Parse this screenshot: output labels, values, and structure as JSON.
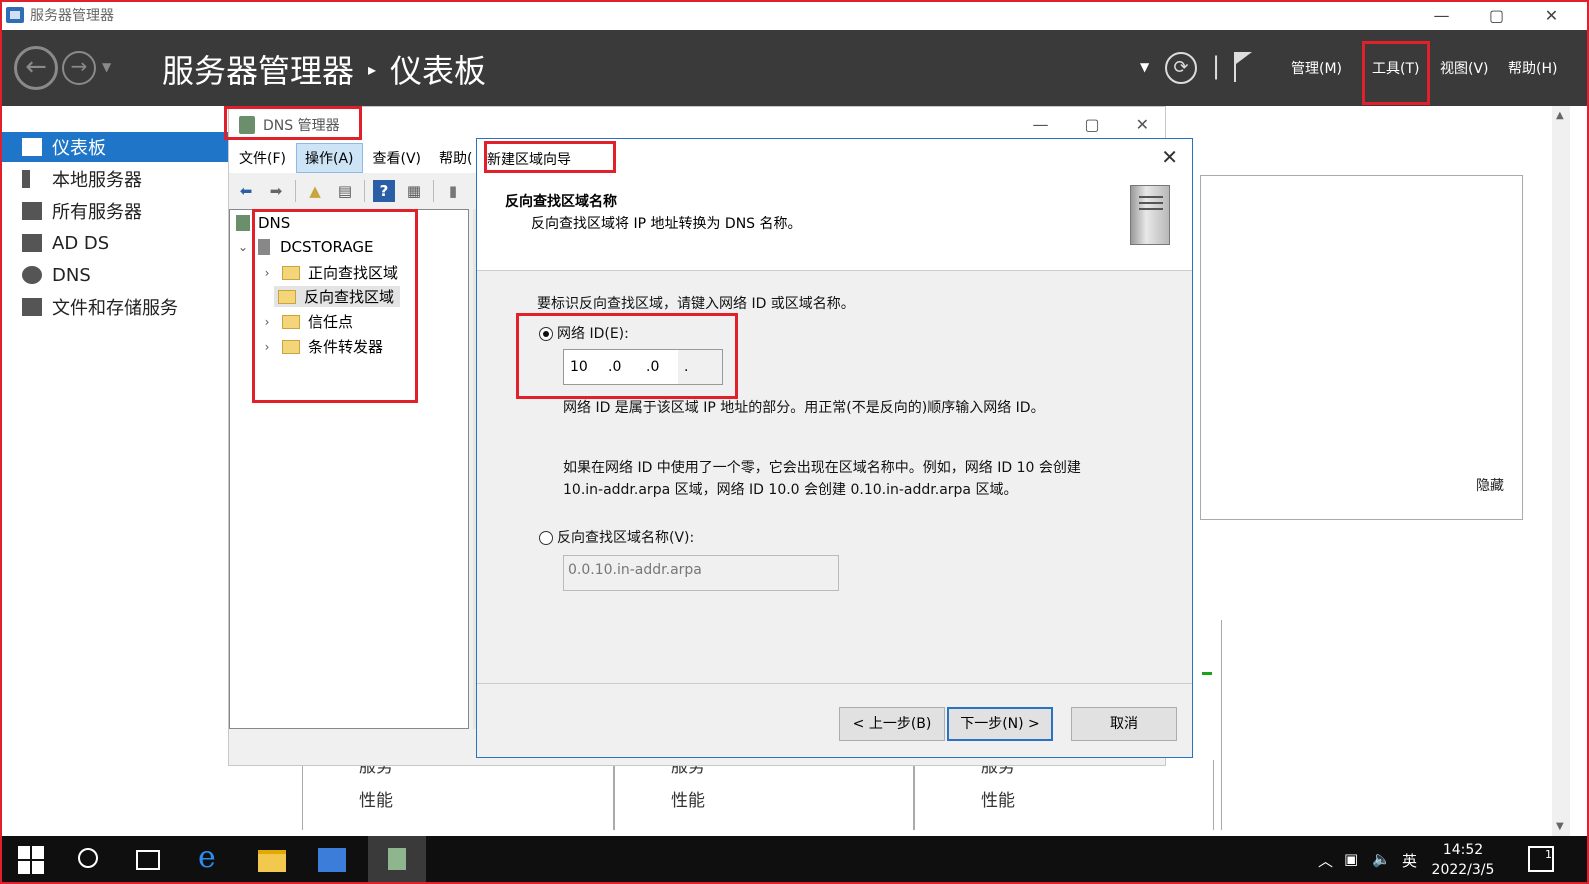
{
  "window": {
    "title": "服务器管理器",
    "min": "—",
    "max": "▢",
    "close": "✕"
  },
  "header": {
    "app_name": "服务器管理器",
    "separator": "▸",
    "page": "仪表板",
    "menus": {
      "manage": "管理(M)",
      "tools": "工具(T)",
      "view": "视图(V)",
      "help": "帮助(H)"
    }
  },
  "sidebar": {
    "items": [
      {
        "label": "仪表板",
        "icon": "dashboard-icon"
      },
      {
        "label": "本地服务器",
        "icon": "server-icon"
      },
      {
        "label": "所有服务器",
        "icon": "servers-icon"
      },
      {
        "label": "AD DS",
        "icon": "adds-icon"
      },
      {
        "label": "DNS",
        "icon": "dns-icon"
      },
      {
        "label": "文件和存储服务",
        "icon": "storage-icon"
      }
    ]
  },
  "main": {
    "hide_link": "隐藏",
    "tiles": [
      {
        "services": "服务",
        "performance": "性能"
      },
      {
        "services": "服务",
        "performance": "性能"
      },
      {
        "services": "服务",
        "performance": "性能"
      }
    ]
  },
  "dns_manager": {
    "title": "DNS 管理器",
    "menus": [
      "文件(F)",
      "操作(A)",
      "查看(V)",
      "帮助("
    ],
    "tree": {
      "root": "DNS",
      "server": "DCSTORAGE",
      "children": [
        "正向查找区域",
        "反向查找区域",
        "信任点",
        "条件转发器"
      ]
    }
  },
  "wizard": {
    "title": "新建区域向导",
    "heading": "反向查找区域名称",
    "subheading": "反向查找区域将 IP 地址转换为 DNS 名称。",
    "instruction": "要标识反向查找区域，请键入网络 ID 或区域名称。",
    "network_id_label": "网络 ID(E):",
    "ip_octets": [
      "10",
      ".0",
      ".0",
      "."
    ],
    "note1": "网络 ID 是属于该区域 IP 地址的部分。用正常(不是反向的)顺序输入网络 ID。",
    "note2_line1": "如果在网络 ID 中使用了一个零，它会出现在区域名称中。例如，网络 ID 10 会创建",
    "note2_line2": "10.in-addr.arpa 区域，网络 ID 10.0 会创建 0.10.in-addr.arpa 区域。",
    "zone_name_label": "反向查找区域名称(V):",
    "zone_name_value": "0.0.10.in-addr.arpa",
    "buttons": {
      "back": "< 上一步(B)",
      "next": "下一步(N) >",
      "cancel": "取消"
    }
  },
  "taskbar": {
    "ime": "英",
    "time": "14:52",
    "date": "2022/3/5",
    "notification_count": "1"
  }
}
